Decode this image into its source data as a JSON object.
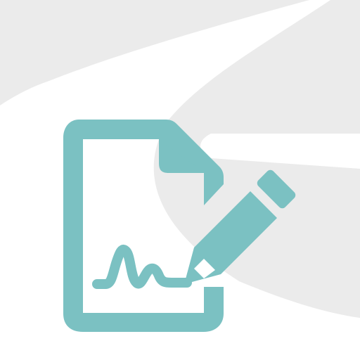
{
  "illustration": {
    "icon": "document-signature-icon",
    "accent_color": "#7bc1c2",
    "background_shape_color": "#ebebeb",
    "background_color": "#ffffff"
  }
}
